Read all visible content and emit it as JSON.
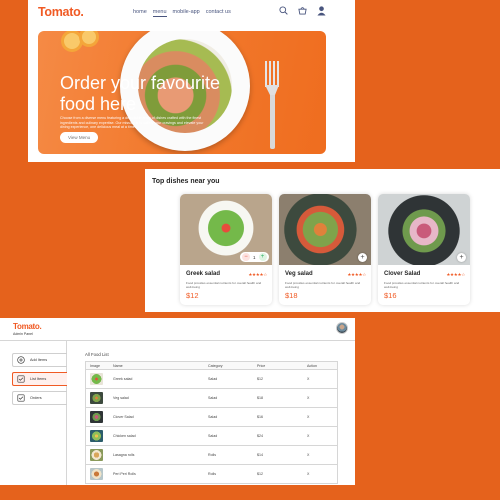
{
  "site": {
    "logo": "Tomato.",
    "nav": [
      "home",
      "menu",
      "mobile-app",
      "contact us"
    ],
    "active_nav": "menu"
  },
  "hero": {
    "title": "Order your favourite food here",
    "description": "Choose from a diverse menu featuring a delectable array of dishes crafted with the finest ingredients and culinary expertise. Our mission is to satisfy your cravings and elevate your dining experience, one delicious meal at a time.",
    "button_label": "View Menu"
  },
  "top_dishes": {
    "title": "Top dishes near you",
    "items": [
      {
        "name": "Greek salad",
        "rating": "★★★★☆",
        "description": "Food provides essential nutrients for overall health and well-being",
        "price": "$12",
        "quantity": "1"
      },
      {
        "name": "Veg salad",
        "rating": "★★★★☆",
        "description": "Food provides essential nutrients for overall health and well-being",
        "price": "$18"
      },
      {
        "name": "Clover Salad",
        "rating": "★★★★☆",
        "description": "Food provides essential nutrients for overall health and well-being",
        "price": "$16"
      }
    ]
  },
  "admin": {
    "logo": "Tomato.",
    "subtitle": "Admin Panel",
    "sidebar": [
      {
        "label": "Add Items",
        "icon": "add-circle-icon"
      },
      {
        "label": "List Items",
        "icon": "list-checklist-icon",
        "active": true
      },
      {
        "label": "Orders",
        "icon": "orders-checklist-icon"
      }
    ],
    "list_title": "All Food List",
    "columns": [
      "Image",
      "Name",
      "Category",
      "Price",
      "Action"
    ],
    "rows": [
      {
        "name": "Greek salad",
        "category": "Salad",
        "price": "$12",
        "action": "X"
      },
      {
        "name": "Veg salad",
        "category": "Salad",
        "price": "$18",
        "action": "X"
      },
      {
        "name": "Clover Salad",
        "category": "Salad",
        "price": "$16",
        "action": "X"
      },
      {
        "name": "Chicken salad",
        "category": "Salad",
        "price": "$24",
        "action": "X"
      },
      {
        "name": "Lasagna rolls",
        "category": "Rolls",
        "price": "$14",
        "action": "X"
      },
      {
        "name": "Peri Peri Rolls",
        "category": "Rolls",
        "price": "$12",
        "action": "X"
      }
    ]
  },
  "colors": {
    "brand": "#f05a24",
    "background": "#e5621c",
    "hero_orange": "#f27a2e",
    "nav_text": "#49557e"
  }
}
